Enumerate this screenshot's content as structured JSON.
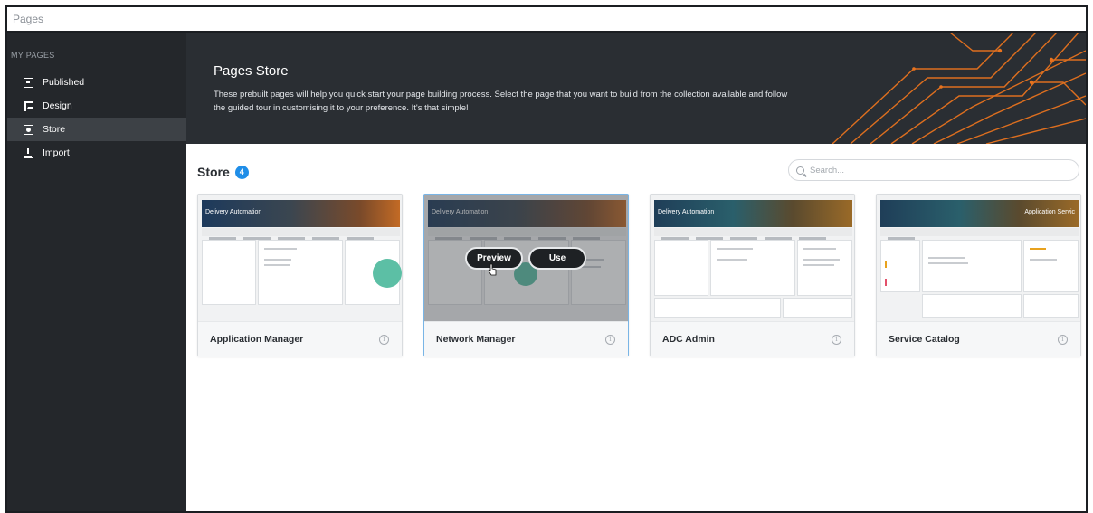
{
  "window": {
    "title": "Pages"
  },
  "sidebar": {
    "section_label": "MY PAGES",
    "items": [
      {
        "label": "Published",
        "icon": "published-icon",
        "active": false
      },
      {
        "label": "Design",
        "icon": "design-icon",
        "active": false
      },
      {
        "label": "Store",
        "icon": "store-icon",
        "active": true
      },
      {
        "label": "Import",
        "icon": "import-icon",
        "active": false
      }
    ]
  },
  "banner": {
    "title": "Pages Store",
    "description": "These prebuilt pages will help you quick start your page building process. Select the page that you want to build from the collection available and follow the guided tour in customising it to your preference. It's that simple!"
  },
  "store": {
    "title": "Store",
    "count": "4",
    "search_placeholder": "Search..."
  },
  "cards": [
    {
      "name": "Application Manager",
      "thumb_title": "Delivery Automation"
    },
    {
      "name": "Network Manager",
      "thumb_title": "Delivery Automation",
      "hover": true,
      "preview_label": "Preview",
      "use_label": "Use"
    },
    {
      "name": "ADC Admin",
      "thumb_title": "Delivery Automation"
    },
    {
      "name": "Service Catalog",
      "thumb_title": "Application Servic"
    }
  ],
  "colors": {
    "sidebar_bg": "#24272b",
    "banner_bg": "#2a2e33",
    "accent": "#1f8ee8",
    "banner_art": "#e8731e"
  }
}
